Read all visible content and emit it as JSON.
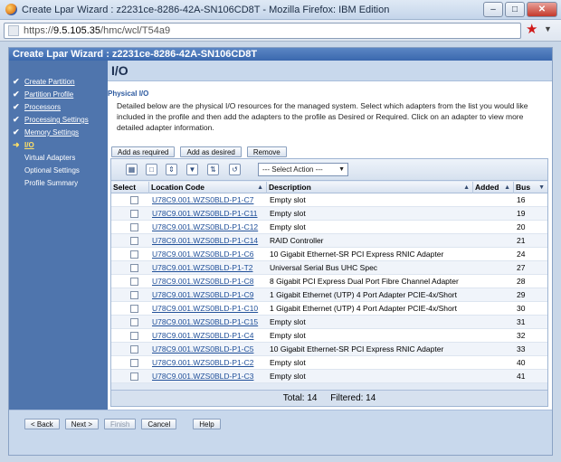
{
  "window": {
    "title": "Create Lpar Wizard : z2231ce-8286-42A-SN106CD8T - Mozilla Firefox: IBM Edition",
    "url_prefix": "https://",
    "url_host": "9.5.105.35",
    "url_path": "/hmc/wcl/T54a9"
  },
  "app": {
    "header": "Create Lpar Wizard : z2231ce-8286-42A-SN106CD8T"
  },
  "sidebar": {
    "items": [
      {
        "label": "Create Partition",
        "state": "done"
      },
      {
        "label": "Partition Profile",
        "state": "done"
      },
      {
        "label": "Processors",
        "state": "done"
      },
      {
        "label": "Processing Settings",
        "state": "done"
      },
      {
        "label": "Memory Settings",
        "state": "done"
      },
      {
        "label": "I/O",
        "state": "current"
      },
      {
        "label": "Virtual Adapters",
        "state": "todo"
      },
      {
        "label": "Optional Settings",
        "state": "todo"
      },
      {
        "label": "Profile Summary",
        "state": "todo"
      }
    ]
  },
  "page": {
    "title": "I/O",
    "section": "Physical I/O",
    "description": "Detailed below are the physical I/O resources for the managed system. Select which adapters from the list you would like included in the profile and then add the adapters to the profile as Desired or Required. Click on an adapter to view more detailed adapter information."
  },
  "actions": {
    "add_required": "Add as required",
    "add_desired": "Add as desired",
    "remove": "Remove"
  },
  "toolbar": {
    "select_action": "--- Select Action ---"
  },
  "table": {
    "headers": {
      "select": "Select",
      "location": "Location Code",
      "description": "Description",
      "added": "Added",
      "bus": "Bus"
    },
    "rows": [
      {
        "loc": "U78C9.001.WZS0BLD-P1-C7",
        "desc": "Empty slot",
        "added": "",
        "bus": "16"
      },
      {
        "loc": "U78C9.001.WZS0BLD-P1-C11",
        "desc": "Empty slot",
        "added": "",
        "bus": "19"
      },
      {
        "loc": "U78C9.001.WZS0BLD-P1-C12",
        "desc": "Empty slot",
        "added": "",
        "bus": "20"
      },
      {
        "loc": "U78C9.001.WZS0BLD-P1-C14",
        "desc": "RAID Controller",
        "added": "",
        "bus": "21"
      },
      {
        "loc": "U78C9.001.WZS0BLD-P1-C6",
        "desc": "10 Gigabit Ethernet-SR PCI Express RNIC Adapter",
        "added": "",
        "bus": "24"
      },
      {
        "loc": "U78C9.001.WZS0BLD-P1-T2",
        "desc": "Universal Serial Bus UHC Spec",
        "added": "",
        "bus": "27"
      },
      {
        "loc": "U78C9.001.WZS0BLD-P1-C8",
        "desc": "8 Gigabit PCI Express Dual Port Fibre Channel Adapter",
        "added": "",
        "bus": "28"
      },
      {
        "loc": "U78C9.001.WZS0BLD-P1-C9",
        "desc": "1 Gigabit Ethernet (UTP) 4 Port Adapter PCIE-4x/Short",
        "added": "",
        "bus": "29"
      },
      {
        "loc": "U78C9.001.WZS0BLD-P1-C10",
        "desc": "1 Gigabit Ethernet (UTP) 4 Port Adapter PCIE-4x/Short",
        "added": "",
        "bus": "30"
      },
      {
        "loc": "U78C9.001.WZS0BLD-P1-C15",
        "desc": "Empty slot",
        "added": "",
        "bus": "31"
      },
      {
        "loc": "U78C9.001.WZS0BLD-P1-C4",
        "desc": "Empty slot",
        "added": "",
        "bus": "32"
      },
      {
        "loc": "U78C9.001.WZS0BLD-P1-C5",
        "desc": "10 Gigabit Ethernet-SR PCI Express RNIC Adapter",
        "added": "",
        "bus": "33"
      },
      {
        "loc": "U78C9.001.WZS0BLD-P1-C2",
        "desc": "Empty slot",
        "added": "",
        "bus": "40"
      },
      {
        "loc": "U78C9.001.WZS0BLD-P1-C3",
        "desc": "Empty slot",
        "added": "",
        "bus": "41"
      }
    ],
    "total_label": "Total: 14",
    "filtered_label": "Filtered: 14"
  },
  "nav": {
    "back": "< Back",
    "next": "Next >",
    "finish": "Finish",
    "cancel": "Cancel",
    "help": "Help"
  }
}
